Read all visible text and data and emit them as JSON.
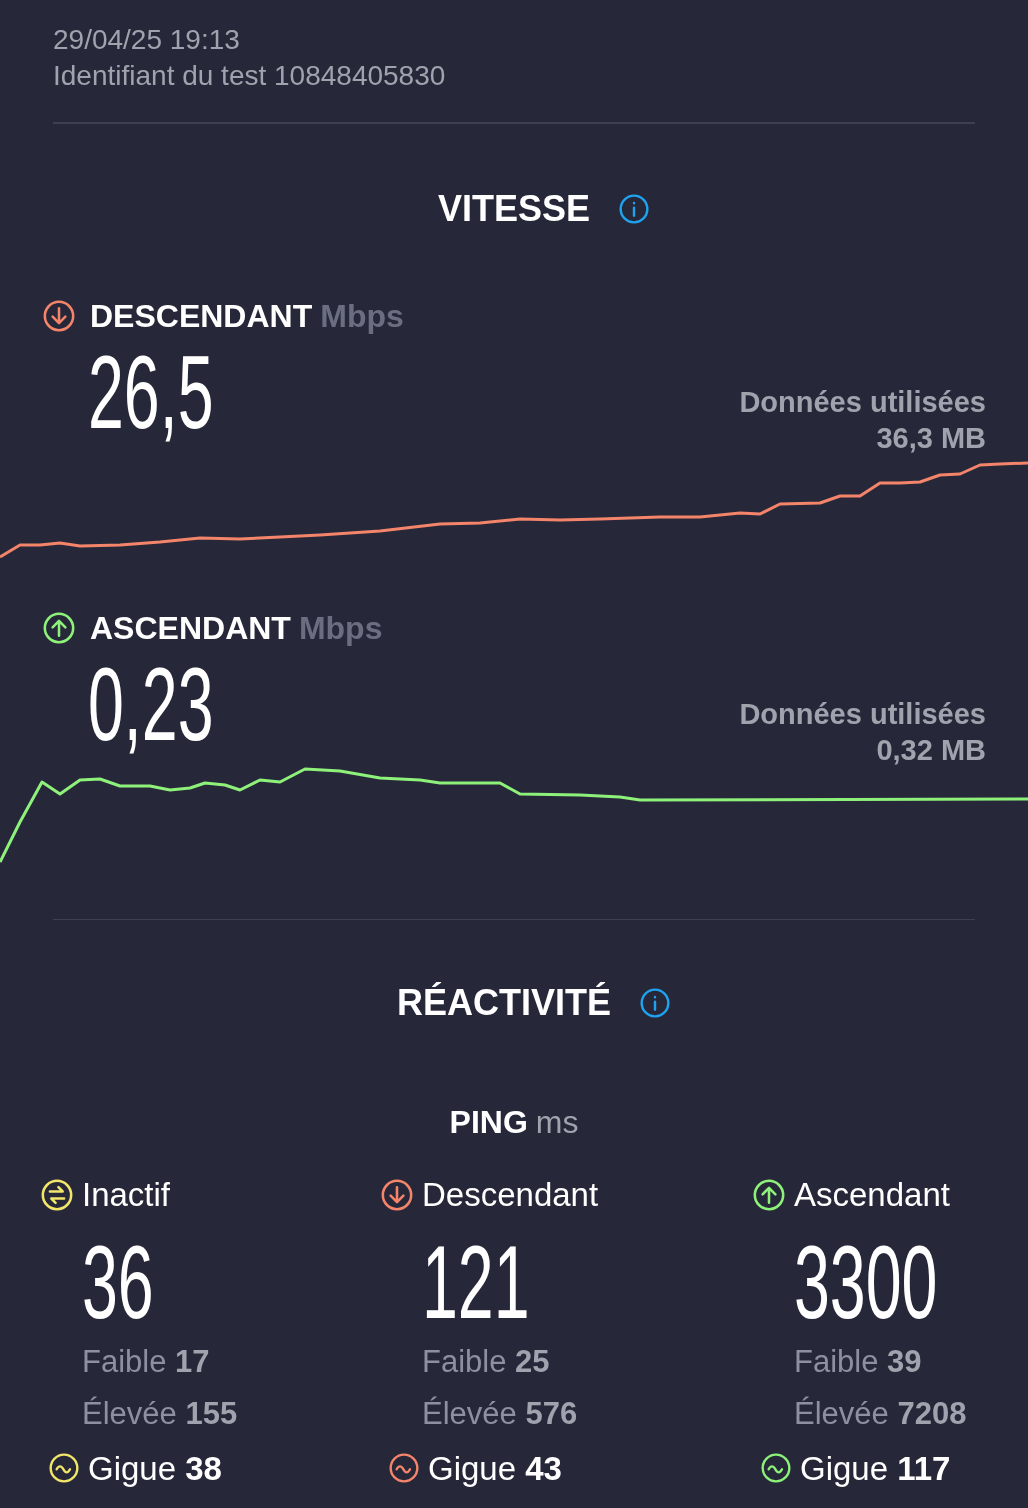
{
  "header": {
    "date": "29/04/25 19:13",
    "test_id": "Identifiant du test 10848405830"
  },
  "speed": {
    "title": "VITESSE",
    "metrics": [
      {
        "kind": "download",
        "label": "DESCENDANT",
        "unit": "Mbps",
        "value": "26,5",
        "data_label": "Données utilisées",
        "data_value": "36,3 MB"
      },
      {
        "kind": "upload",
        "label": "ASCENDANT",
        "unit": "Mbps",
        "value": "0,23",
        "data_label": "Données utilisées",
        "data_value": "0,32 MB"
      }
    ]
  },
  "responsiveness": {
    "title": "RÉACTIVITÉ",
    "ping_label": "PING",
    "ping_unit": "ms",
    "columns": [
      {
        "kind": "idle",
        "label": "Inactif",
        "value": "36",
        "low_label": "Faible",
        "low": "17",
        "high_label": "Élevée",
        "high": "155",
        "jitter_label": "Gigue",
        "jitter": "38"
      },
      {
        "kind": "download",
        "label": "Descendant",
        "value": "121",
        "low_label": "Faible",
        "low": "25",
        "high_label": "Élevée",
        "high": "576",
        "jitter_label": "Gigue",
        "jitter": "43"
      },
      {
        "kind": "upload",
        "label": "Ascendant",
        "value": "3300",
        "low_label": "Faible",
        "low": "39",
        "high_label": "Élevée",
        "high": "7208",
        "jitter_label": "Gigue",
        "jitter": "117"
      }
    ]
  }
}
